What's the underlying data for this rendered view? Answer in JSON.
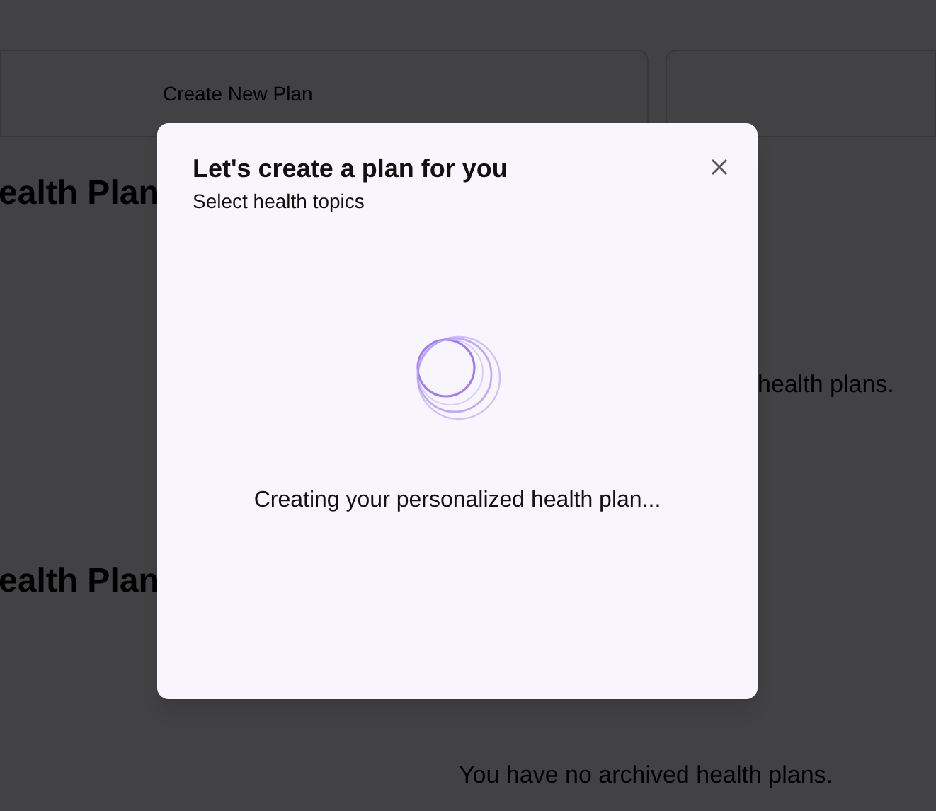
{
  "background": {
    "create_card": {
      "label": "Create New Plan"
    },
    "active_section": {
      "heading": "ealth Plan",
      "empty_message": "health plans."
    },
    "archived_section": {
      "heading": "ealth Plan",
      "empty_message": "You have no archived health plans."
    }
  },
  "dialog": {
    "title": "Let's create a plan for you",
    "subtitle": "Select health topics",
    "status": "Creating your personalized health plan..."
  }
}
